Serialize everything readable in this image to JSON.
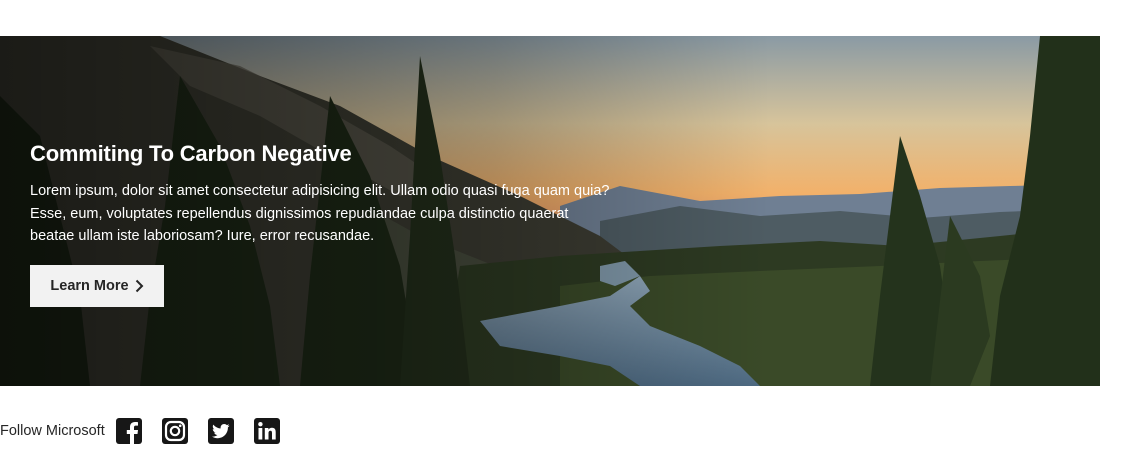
{
  "hero": {
    "title": "Commiting To Carbon Negative",
    "body": "Lorem ipsum, dolor sit amet consectetur adipisicing elit. Ullam odio quasi fuga quam quia? Esse, eum, voluptates repellendus dignissimos repudiandae culpa distinctio quaerat beatae ullam iste laboriosam? Iure, error recusandae.",
    "button_label": "Learn More",
    "button_icon": "chevron-right-icon",
    "background_image": "forest-lake-sunset"
  },
  "follow": {
    "label": "Follow Microsoft",
    "networks": [
      {
        "name": "facebook",
        "icon": "facebook-icon"
      },
      {
        "name": "instagram",
        "icon": "instagram-icon"
      },
      {
        "name": "twitter",
        "icon": "twitter-icon"
      },
      {
        "name": "linkedin",
        "icon": "linkedin-icon"
      }
    ]
  },
  "colors": {
    "button_bg": "#f2f2f2",
    "button_text": "#262626",
    "hero_text": "#ffffff",
    "icon": "#171717"
  }
}
